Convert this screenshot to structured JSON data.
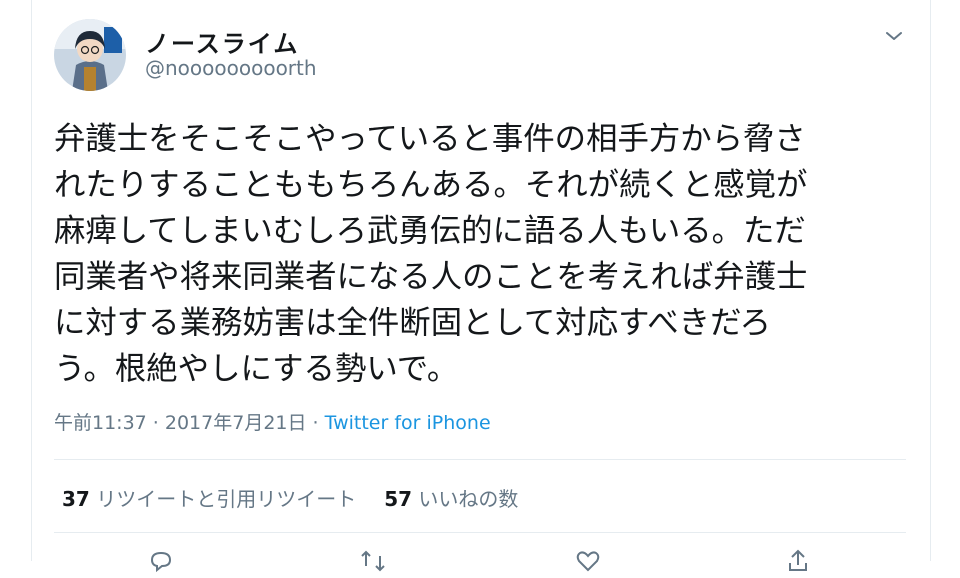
{
  "author": {
    "display_name": "ノースライム",
    "handle": "@nooooooooorth"
  },
  "tweet": {
    "text": "弁護士をそこそこやっていると事件の相手方から脅さ\nれたりすることももちろんある。それが続くと感覚が\n麻痺してしまいむしろ武勇伝的に語る人もいる。ただ\n同業者や将来同業者になる人のことを考えれば弁護士\nに対する業務妨害は全件断固として対応すべきだろ\nう。根絶やしにする勢いで。",
    "timestamp": "午前11:37 · 2017年7月21日 · ",
    "source": "Twitter for iPhone"
  },
  "stats": {
    "retweets_count": "37",
    "retweets_label": "リツイートと引用リツイート",
    "likes_count": "57",
    "likes_label": "いいねの数"
  },
  "icons": {
    "menu": "chevron-down-icon",
    "reply": "reply-icon",
    "retweet": "retweet-icon",
    "like": "heart-icon",
    "share": "share-icon"
  },
  "colors": {
    "link": "#1b95e0",
    "secondary_text": "#657786",
    "primary_text": "#14171a",
    "divider": "#e6ecf0"
  }
}
